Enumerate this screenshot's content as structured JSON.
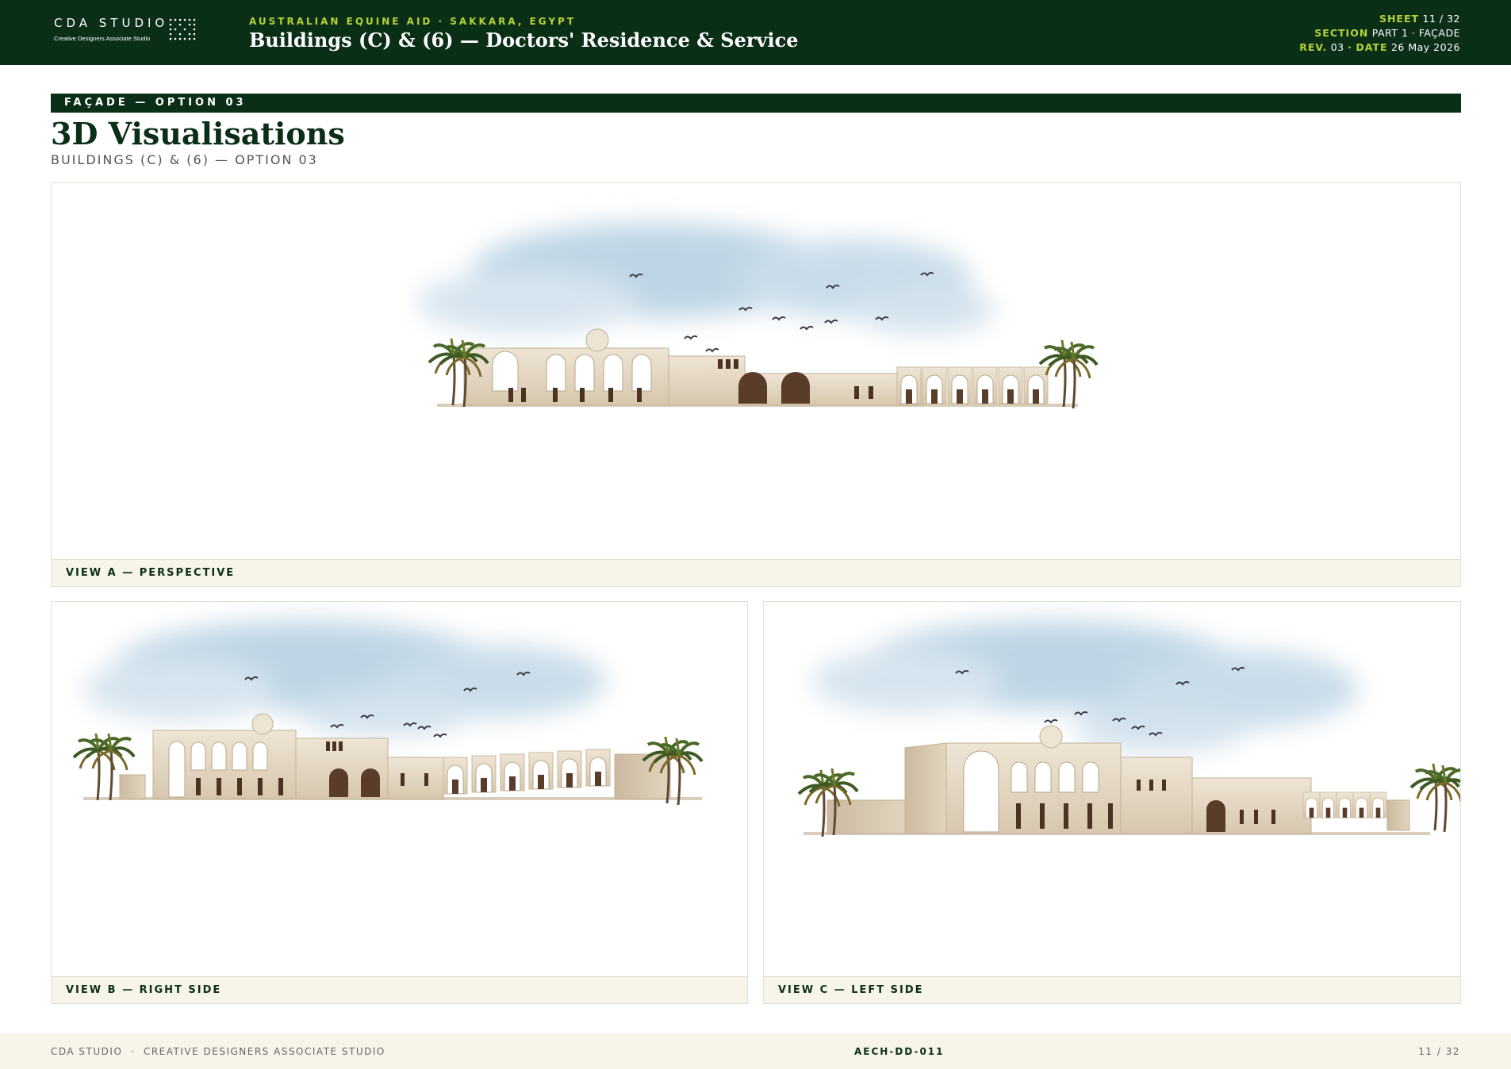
{
  "header": {
    "logo_title": "CDA STUDIO",
    "logo_subtitle": "Creative Designers Associate Studio",
    "kicker": "AUSTRALIAN EQUINE AID · SAKKARA, EGYPT",
    "title": "Buildings (C) & (6) — Doctors' Residence & Service",
    "sheet_label": "SHEET",
    "sheet_value": "11 / 32",
    "section_label": "SECTION",
    "section_value": "PART 1 · FAÇADE",
    "rev_label": "REV.",
    "rev_value": "03",
    "separator": "·",
    "date_label": "DATE",
    "date_value": "26 May 2026"
  },
  "section": {
    "label": "FAÇADE — OPTION 03",
    "title": "3D Visualisations",
    "subtitle": "BUILDINGS (C) & (6) — OPTION 03"
  },
  "views": [
    {
      "caption": "VIEW A — PERSPECTIVE"
    },
    {
      "caption": "VIEW B — RIGHT SIDE"
    },
    {
      "caption": "VIEW C — LEFT SIDE"
    }
  ],
  "footer": {
    "left": "CDA STUDIO  ·  CREATIVE DESIGNERS ASSOCIATE STUDIO",
    "center": "AECH-DD-011",
    "right": "11 / 32"
  },
  "colors": {
    "header_bg": "#0b2e17",
    "accent": "#b5d334",
    "caption_bg": "#f7f4ea",
    "building": "#e3d6c2",
    "sky": "#b9d3e4"
  }
}
